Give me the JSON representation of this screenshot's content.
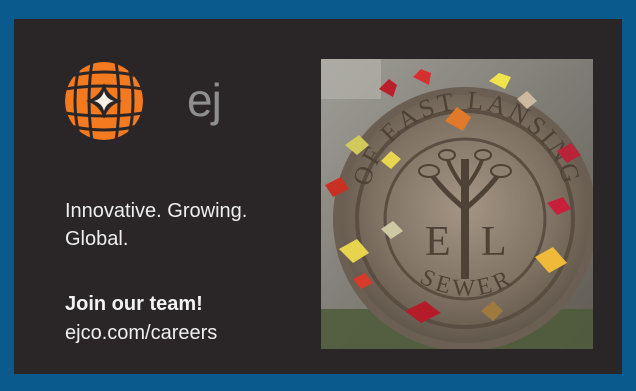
{
  "brand": {
    "logo_icon": "globe-logo-icon",
    "logo_text": "ej",
    "accent_color": "#f47a20"
  },
  "tagline": "Innovative. Growing. Global.",
  "cta": {
    "heading": "Join our team!",
    "link": "ejco.com/careers"
  },
  "photo": {
    "ring_text_top": "OF EAST LANSING",
    "ring_text_bottom": "SEWER",
    "center_letters": [
      "E",
      "L"
    ],
    "subject_icon": "manhole-cover-with-leaves"
  }
}
